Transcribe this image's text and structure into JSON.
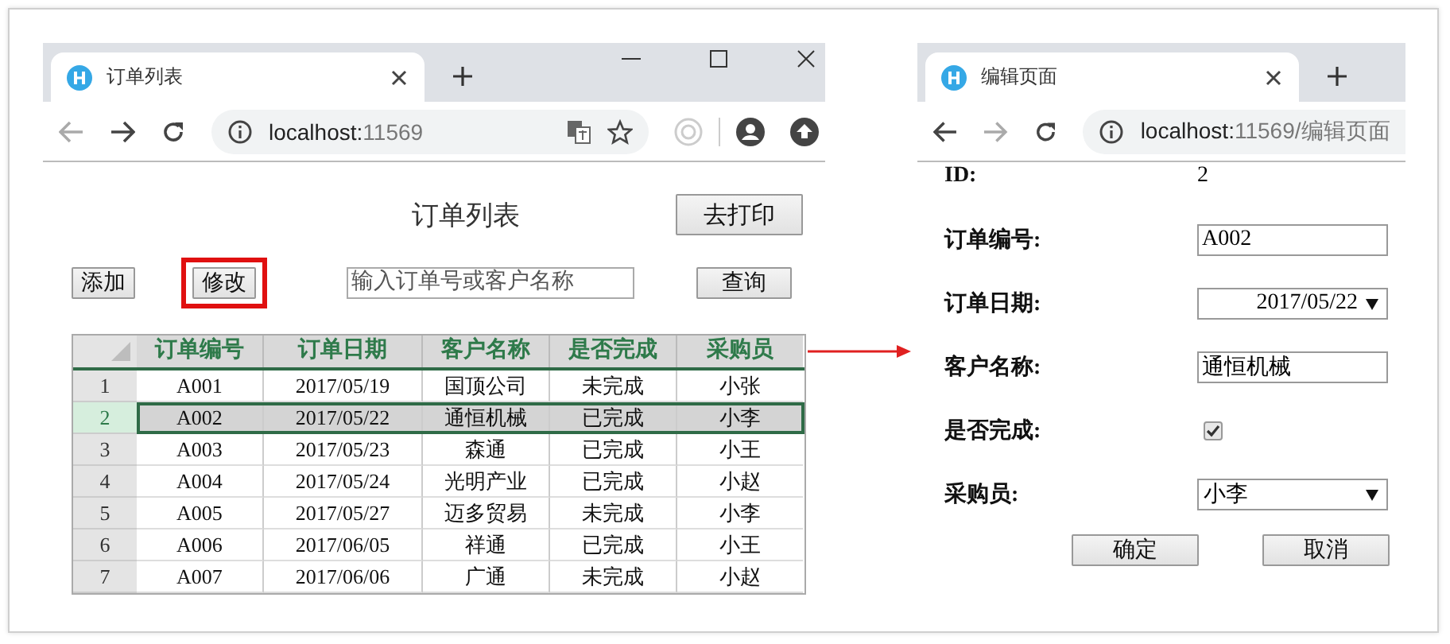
{
  "list_window": {
    "tab_title": "订单列表",
    "url_host": "localhost:",
    "url_path": "11569",
    "page_title": "订单列表",
    "print_button": "去打印",
    "actions": [
      {
        "label": "添加",
        "highlighted": false
      },
      {
        "label": "修改",
        "highlighted": true
      }
    ],
    "search": {
      "placeholder": "输入订单号或客户名称"
    },
    "query_button": "查询",
    "table": {
      "columns": [
        "订单编号",
        "订单日期",
        "客户名称",
        "是否完成",
        "采购员"
      ],
      "rows": [
        {
          "number": "1",
          "cells": [
            "A001",
            "2017/05/19",
            "国顶公司",
            "未完成",
            "小张"
          ],
          "selected": false
        },
        {
          "number": "2",
          "cells": [
            "A002",
            "2017/05/22",
            "通恒机械",
            "已完成",
            "小李"
          ],
          "selected": true
        },
        {
          "number": "3",
          "cells": [
            "A003",
            "2017/05/23",
            "森通",
            "已完成",
            "小王"
          ],
          "selected": false
        },
        {
          "number": "4",
          "cells": [
            "A004",
            "2017/05/24",
            "光明产业",
            "已完成",
            "小赵"
          ],
          "selected": false
        },
        {
          "number": "5",
          "cells": [
            "A005",
            "2017/05/27",
            "迈多贸易",
            "未完成",
            "小李"
          ],
          "selected": false
        },
        {
          "number": "6",
          "cells": [
            "A006",
            "2017/06/05",
            "祥通",
            "已完成",
            "小王"
          ],
          "selected": false
        },
        {
          "number": "7",
          "cells": [
            "A007",
            "2017/06/06",
            "广通",
            "未完成",
            "小赵"
          ],
          "selected": false
        }
      ]
    }
  },
  "edit_window": {
    "tab_title": "编辑页面",
    "url_host": "localhost:",
    "url_path": "11569/编辑页面",
    "fields": [
      {
        "label": "ID:",
        "kind": "text",
        "value": "2"
      },
      {
        "label": "订单编号:",
        "kind": "input",
        "value": "A002"
      },
      {
        "label": "订单日期:",
        "kind": "date",
        "value": "2017/05/22"
      },
      {
        "label": "客户名称:",
        "kind": "input",
        "value": "通恒机械"
      },
      {
        "label": "是否完成:",
        "kind": "checkbox",
        "checked": true
      },
      {
        "label": "采购员:",
        "kind": "select",
        "value": "小李"
      }
    ],
    "buttons": [
      "确定",
      "取消"
    ]
  }
}
